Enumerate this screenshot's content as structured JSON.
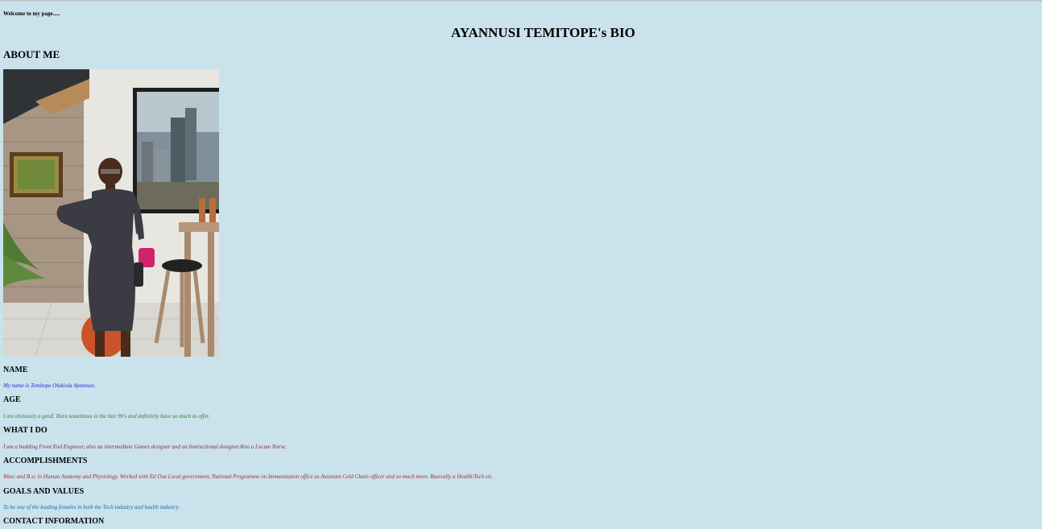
{
  "header": {
    "welcome": "Welcome to my page.....",
    "title": "AYANNUSI TEMITOPE's BIO",
    "about_heading": "ABOUT ME"
  },
  "photo": {
    "description_icon": "profile-photo"
  },
  "sections": [
    {
      "heading": "NAME",
      "text": "My name is Temitope Olukiola Ayannusi.",
      "color": "#1b1fcf"
    },
    {
      "heading": "AGE",
      "text": "I am obviously a genZ. Born sometimes in the late 90's and definitely have so much to offer.",
      "color": "#2e7d32"
    },
    {
      "heading": "WHAT I DO",
      "text": "I am a budding Front End Engineer, also an intermediate Games designer and an Instructional designer.Also a Locum Nurse.",
      "color": "#8b2252"
    },
    {
      "heading": "ACCOMPLISHMENTS",
      "text": "Waec and B.sc in Human Anatomy and Physiology. Worked with Eti Osa Local government, National Programme on Immunization office as Assistant Cold Chain officer and so much more. Basically a Health/Tech sis.",
      "color": "#a52a2a"
    },
    {
      "heading": "GOALS AND VALUES",
      "text": "To be one of the leading females in both the Tech industry and health industry.",
      "color": "#1565a8"
    },
    {
      "heading": "CONTACT INFORMATION",
      "text": "",
      "color": "#000000"
    }
  ]
}
